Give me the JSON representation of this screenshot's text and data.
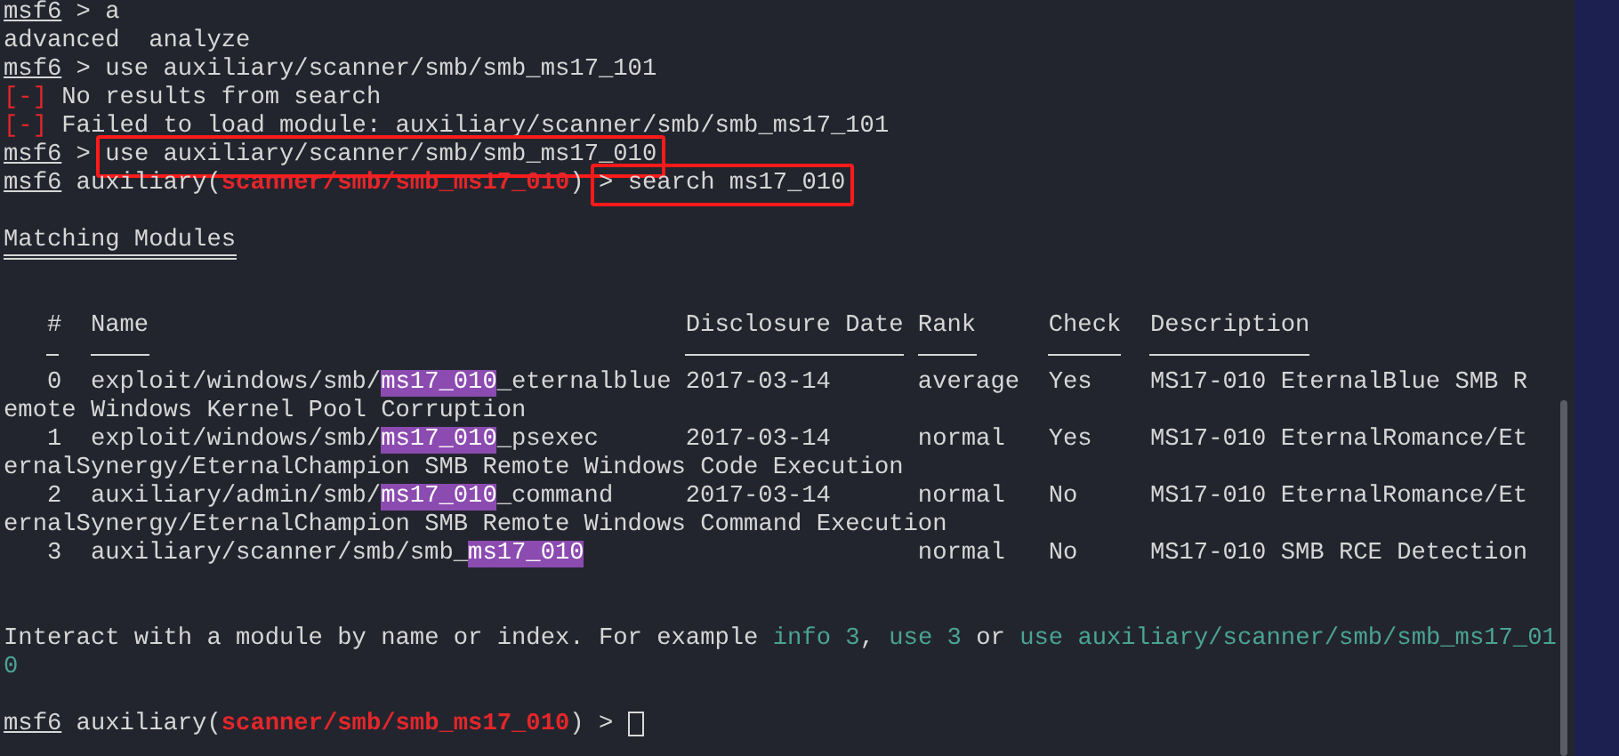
{
  "lines_before": [
    {
      "kind": "text",
      "segments": [
        {
          "kind": "prompt",
          "text": "msf6"
        },
        {
          "kind": "plain",
          "text": " > a"
        }
      ]
    },
    {
      "kind": "text",
      "segments": [
        {
          "kind": "plain",
          "text": "advanced  analyze"
        }
      ]
    },
    {
      "kind": "text",
      "segments": [
        {
          "kind": "prompt",
          "text": "msf6"
        },
        {
          "kind": "plain",
          "text": " > use auxiliary/scanner/smb/smb_ms17_101"
        }
      ]
    },
    {
      "kind": "text",
      "segments": [
        {
          "kind": "error",
          "text": "[-]"
        },
        {
          "kind": "plain",
          "text": " No results from search"
        }
      ]
    },
    {
      "kind": "text",
      "segments": [
        {
          "kind": "error",
          "text": "[-]"
        },
        {
          "kind": "plain",
          "text": " Failed to load module: auxiliary/scanner/smb/smb_ms17_101"
        }
      ]
    },
    {
      "kind": "text",
      "segments": [
        {
          "kind": "prompt",
          "text": "msf6"
        },
        {
          "kind": "plain",
          "text": " > "
        },
        {
          "kind": "plain",
          "text": "use auxiliary/scanner/smb/smb_ms17_010",
          "boxed": true
        }
      ]
    },
    {
      "kind": "text",
      "segments": [
        {
          "kind": "prompt",
          "text": "msf6"
        },
        {
          "kind": "plain",
          "text": " auxiliary("
        },
        {
          "kind": "module",
          "text": "scanner/smb/smb_ms17_010"
        },
        {
          "kind": "plain",
          "text": ") "
        },
        {
          "kind": "plain",
          "text": "> search ms17_010",
          "boxed": true
        }
      ]
    },
    {
      "kind": "blank"
    }
  ],
  "matching_title": "Matching Modules",
  "table": {
    "columns": [
      {
        "label": "#"
      },
      {
        "label": "Name"
      },
      {
        "label": "Disclosure Date"
      },
      {
        "label": "Rank"
      },
      {
        "label": "Check"
      },
      {
        "label": "Description"
      }
    ],
    "rows": [
      {
        "index": "0",
        "name_prefix": "exploit/windows/smb/",
        "match": "ms17_010",
        "name_suffix": "_eternalblue",
        "date": "2017-03-14",
        "rank": "average",
        "check": "Yes",
        "description": "MS17-010 EternalBlue SMB R",
        "wrap": "emote Windows Kernel Pool Corruption"
      },
      {
        "index": "1",
        "name_prefix": "exploit/windows/smb/",
        "match": "ms17_010",
        "name_suffix": "_psexec",
        "date": "2017-03-14",
        "rank": "normal",
        "check": "Yes",
        "description": "MS17-010 EternalRomance/Et",
        "wrap": "ernalSynergy/EternalChampion SMB Remote Windows Code Execution"
      },
      {
        "index": "2",
        "name_prefix": "auxiliary/admin/smb/",
        "match": "ms17_010",
        "name_suffix": "_command",
        "date": "2017-03-14",
        "rank": "normal",
        "check": "No",
        "description": "MS17-010 EternalRomance/Et",
        "wrap": "ernalSynergy/EternalChampion SMB Remote Windows Command Execution"
      },
      {
        "index": "3",
        "name_prefix": "auxiliary/scanner/smb/smb_",
        "match": "ms17_010",
        "rank": "normal",
        "check": "No",
        "description": "MS17-010 SMB RCE Detection"
      }
    ]
  },
  "lines_after": [
    {
      "kind": "blank"
    },
    {
      "kind": "blank"
    },
    {
      "kind": "text",
      "segments": [
        {
          "kind": "plain",
          "text": "Interact with a module by name or index. For example "
        },
        {
          "kind": "hint",
          "text": "info 3"
        },
        {
          "kind": "plain",
          "text": ", "
        },
        {
          "kind": "hint",
          "text": "use 3"
        },
        {
          "kind": "plain",
          "text": " or "
        },
        {
          "kind": "hint",
          "text": "use auxiliary/scanner/smb/smb_ms17_01"
        }
      ]
    },
    {
      "kind": "text",
      "segments": [
        {
          "kind": "hint",
          "text": "0"
        }
      ]
    },
    {
      "kind": "blank"
    },
    {
      "kind": "text",
      "segments": [
        {
          "kind": "prompt",
          "text": "msf6"
        },
        {
          "kind": "plain",
          "text": " auxiliary("
        },
        {
          "kind": "module",
          "text": "scanner/smb/smb_ms17_010"
        },
        {
          "kind": "plain",
          "text": ")"
        },
        {
          "kind": "plain",
          "text": " > "
        },
        {
          "kind": "cursor"
        }
      ]
    }
  ]
}
